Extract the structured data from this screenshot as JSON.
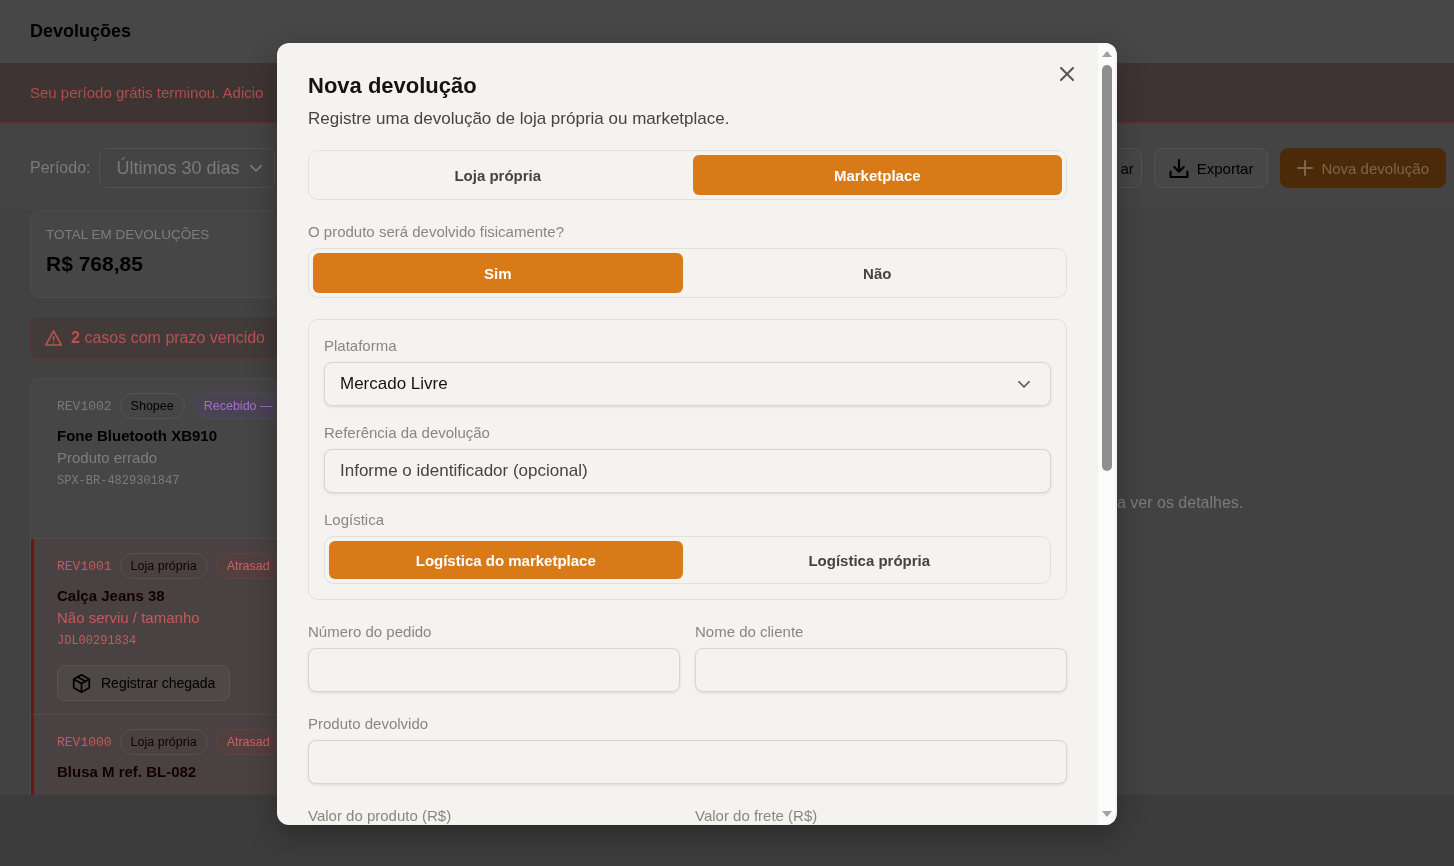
{
  "header": {
    "title": "Devoluções"
  },
  "banner": {
    "text": "Seu período grátis terminou. Adicio"
  },
  "toolbar": {
    "period_label": "Período:",
    "period_value": "Últimos 30 dias",
    "buttons": [
      {
        "label": "ar",
        "kind": "plain"
      },
      {
        "label": "Exportar",
        "kind": "export"
      },
      {
        "label": "Nova devolução",
        "kind": "create"
      }
    ]
  },
  "summary": {
    "label": "TOTAL EM DEVOLUÇÕES",
    "value": "R$ 768,85"
  },
  "alert": {
    "text": "**2** casos com prazo vencido"
  },
  "returns": [
    {
      "id": "REV1002",
      "overdue": false,
      "tags": [
        {
          "text": "Shopee",
          "kind": "channel"
        },
        {
          "text": "Recebido —",
          "kind": "received"
        }
      ],
      "product": "Fone Bluetooth XB910",
      "reason": "Produto errado",
      "tracking": "SPX-BR-4829301847"
    },
    {
      "id": "REV1001",
      "overdue": true,
      "tags": [
        {
          "text": "Loja própria",
          "kind": "channel"
        },
        {
          "text": "Atrasad",
          "kind": "late"
        }
      ],
      "product": "Calça Jeans 38",
      "reason": "Não serviu / tamanho",
      "tracking": "JDL00291834",
      "action": "Registrar chegada"
    },
    {
      "id": "REV1000",
      "overdue": true,
      "tags": [
        {
          "text": "Loja própria",
          "kind": "channel"
        },
        {
          "text": "Atrasad",
          "kind": "late"
        }
      ],
      "product": "Blusa M ref. BL-082"
    }
  ],
  "detail_hint": "a ver os detalhes.",
  "modal": {
    "title": "Nova devolução",
    "subtitle": "Registre uma devolução de loja própria ou marketplace.",
    "store_type": [
      {
        "label": "Loja própria",
        "selected": false
      },
      {
        "label": "Marketplace",
        "selected": true
      }
    ],
    "physical_return": {
      "label": "O produto será devolvido fisicamente?",
      "options": [
        {
          "label": "Sim",
          "selected": true
        },
        {
          "label": "Não",
          "selected": false
        }
      ]
    },
    "marketplace": {
      "platform": {
        "label": "Plataforma",
        "value": "Mercado Livre"
      },
      "reference": {
        "label": "Referência da devolução",
        "placeholder": "Informe o identificador (opcional)"
      },
      "logistics": {
        "label": "Logística",
        "options": [
          {
            "label": "Logística do marketplace",
            "selected": true
          },
          {
            "label": "Logística própria",
            "selected": false
          }
        ]
      }
    },
    "fields": [
      {
        "label": "Número do pedido",
        "kind": "half",
        "input_shown": true
      },
      {
        "label": "Nome do cliente",
        "kind": "half",
        "input_shown": true
      },
      {
        "label": "Produto devolvido",
        "kind": "full",
        "input_shown": true
      },
      {
        "label": "Valor do produto (R$)",
        "kind": "half",
        "input_shown": false
      },
      {
        "label": "Valor do frete (R$)",
        "kind": "half",
        "input_shown": false
      }
    ]
  }
}
